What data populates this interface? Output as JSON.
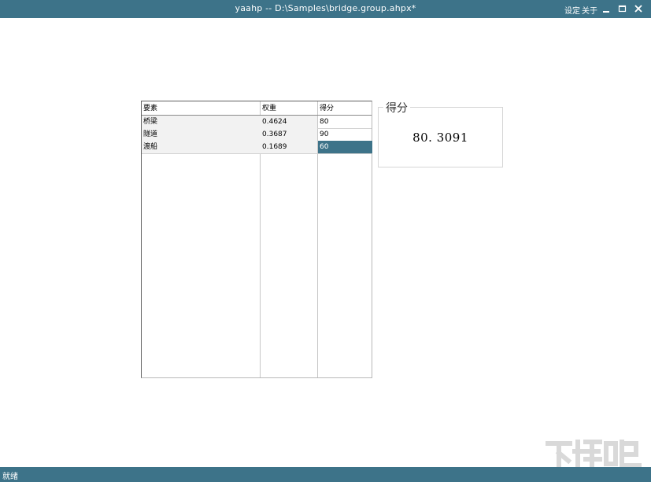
{
  "window": {
    "title": "yaahp -- D:\\Samples\\bridge.group.ahpx*",
    "menu": {
      "settings": "设定",
      "about": "关于"
    }
  },
  "grid": {
    "headers": [
      "要素",
      "权重",
      "得分"
    ],
    "rows": [
      {
        "element": "桥梁",
        "weight": "0.4624",
        "score": "80",
        "selected": false
      },
      {
        "element": "隧道",
        "weight": "0.3687",
        "score": "90",
        "selected": false
      },
      {
        "element": "渡船",
        "weight": "0.1689",
        "score": "60",
        "selected": true
      }
    ]
  },
  "score_panel": {
    "legend": "得分",
    "value": "80. 3091"
  },
  "status": {
    "text": "就绪"
  },
  "colors": {
    "accent": "#3d7389",
    "selected_cell": "#3d7389"
  }
}
